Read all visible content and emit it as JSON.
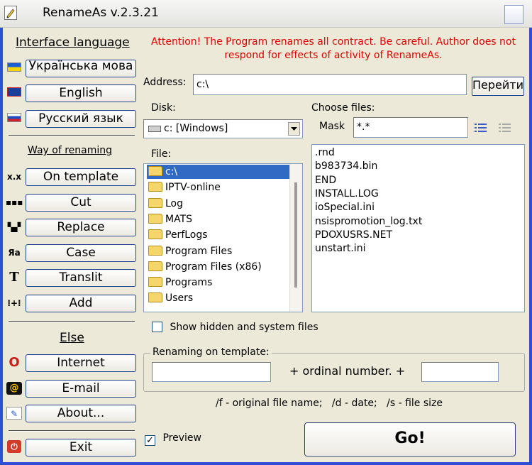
{
  "window": {
    "title": "RenameAs v.2.3.21"
  },
  "left": {
    "interface_language": "Interface language",
    "languages": [
      {
        "label": "Українська мова",
        "icon": "ukraine-flag-icon"
      },
      {
        "label": "English",
        "icon": "uk-flag-icon"
      },
      {
        "label": "Русский язык",
        "icon": "russia-flag-icon"
      }
    ],
    "way_of_renaming": "Way of renaming",
    "modes": [
      {
        "label": "On template",
        "icon": "template-icon",
        "glyph": "x.x"
      },
      {
        "label": "Cut",
        "icon": "cut-icon",
        "glyph": "▪▪▪"
      },
      {
        "label": "Replace",
        "icon": "replace-icon",
        "glyph": "▚▞"
      },
      {
        "label": "Case",
        "icon": "case-icon",
        "glyph": "Яа"
      },
      {
        "label": "Translit",
        "icon": "translit-icon",
        "glyph": "T"
      },
      {
        "label": "Add",
        "icon": "add-icon",
        "glyph": "⁝+⁝"
      }
    ],
    "else": "Else",
    "extras": [
      {
        "label": "Internet",
        "icon": "opera-icon",
        "glyph": "O"
      },
      {
        "label": "E-mail",
        "icon": "email-icon",
        "glyph": "@"
      },
      {
        "label": "About...",
        "icon": "about-icon",
        "glyph": "✎"
      }
    ],
    "exit": {
      "label": "Exit",
      "icon": "exit-icon",
      "glyph": "⏻"
    }
  },
  "main": {
    "attention": "Attention! The Program renames all contract. Be careful. Author does not respond for effects of activity of RenameAs.",
    "address_label": "Address:",
    "address_value": "c:\\",
    "go_button": "Перейти",
    "disk_label": "Disk:",
    "disk_value": "c: [Windows]",
    "choose_files_label": "Choose files:",
    "mask_label": "Mask",
    "mask_value": "*.*",
    "file_label": "File:",
    "folders": [
      "c:\\",
      "IPTV-online",
      "Log",
      "MATS",
      "PerfLogs",
      "Program Files",
      "Program Files (x86)",
      "Programs",
      "Users"
    ],
    "files": [
      ".rnd",
      "b983734.bin",
      "END",
      "INSTALL.LOG",
      "ioSpecial.ini",
      "nsispromotion_log.txt",
      "PDOXUSRS.NET",
      "unstart.ini"
    ],
    "show_hidden_label": "Show hidden and system files",
    "show_hidden_checked": false,
    "template_group_label": "Renaming on template:",
    "template_prefix": "",
    "ordinal_text": "+ ordinal number. +",
    "template_suffix": "",
    "hint": "/f - original file name;   /d - date;   /s - file size",
    "preview_label": "Preview",
    "preview_checked": true,
    "go_label": "Go!"
  }
}
